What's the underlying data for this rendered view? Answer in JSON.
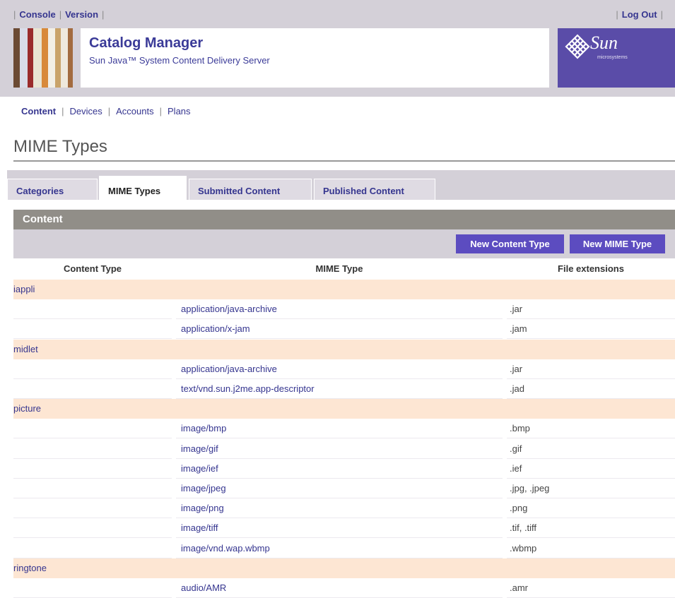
{
  "utility": {
    "console": "Console",
    "version": "Version",
    "logout": "Log Out"
  },
  "header": {
    "title": "Catalog Manager",
    "subtitle": "Sun Java™ System Content Delivery Server",
    "brand": "Sun",
    "brand_sub": "microsystems"
  },
  "nav": {
    "items": [
      "Content",
      "Devices",
      "Accounts",
      "Plans"
    ],
    "current": "Content"
  },
  "page": {
    "title": "MIME Types"
  },
  "tabs": [
    "Categories",
    "MIME Types",
    "Submitted Content",
    "Published Content"
  ],
  "active_tab": "MIME Types",
  "section": {
    "title": "Content",
    "buttons": {
      "new_content_type": "New Content Type",
      "new_mime_type": "New MIME Type"
    }
  },
  "table": {
    "headers": [
      "Content Type",
      "MIME Type",
      "File extensions"
    ],
    "groups": [
      {
        "content_type": "iappli",
        "rows": [
          {
            "mime": "application/java-archive",
            "ext": ".jar"
          },
          {
            "mime": "application/x-jam",
            "ext": ".jam"
          }
        ]
      },
      {
        "content_type": "midlet",
        "rows": [
          {
            "mime": "application/java-archive",
            "ext": ".jar"
          },
          {
            "mime": "text/vnd.sun.j2me.app-descriptor",
            "ext": ".jad"
          }
        ]
      },
      {
        "content_type": "picture",
        "rows": [
          {
            "mime": "image/bmp",
            "ext": ".bmp"
          },
          {
            "mime": "image/gif",
            "ext": ".gif"
          },
          {
            "mime": "image/ief",
            "ext": ".ief"
          },
          {
            "mime": "image/jpeg",
            "ext": ".jpg, .jpeg"
          },
          {
            "mime": "image/png",
            "ext": ".png"
          },
          {
            "mime": "image/tiff",
            "ext": ".tif, .tiff"
          },
          {
            "mime": "image/vnd.wap.wbmp",
            "ext": ".wbmp"
          }
        ]
      },
      {
        "content_type": "ringtone",
        "rows": [
          {
            "mime": "audio/AMR",
            "ext": ".amr"
          }
        ]
      }
    ]
  },
  "colors": {
    "accent": "#5c4cc0",
    "link": "#35358f",
    "category_row": "#fde6d3",
    "section_header": "#918e88",
    "masthead": "#d4d0d8"
  }
}
